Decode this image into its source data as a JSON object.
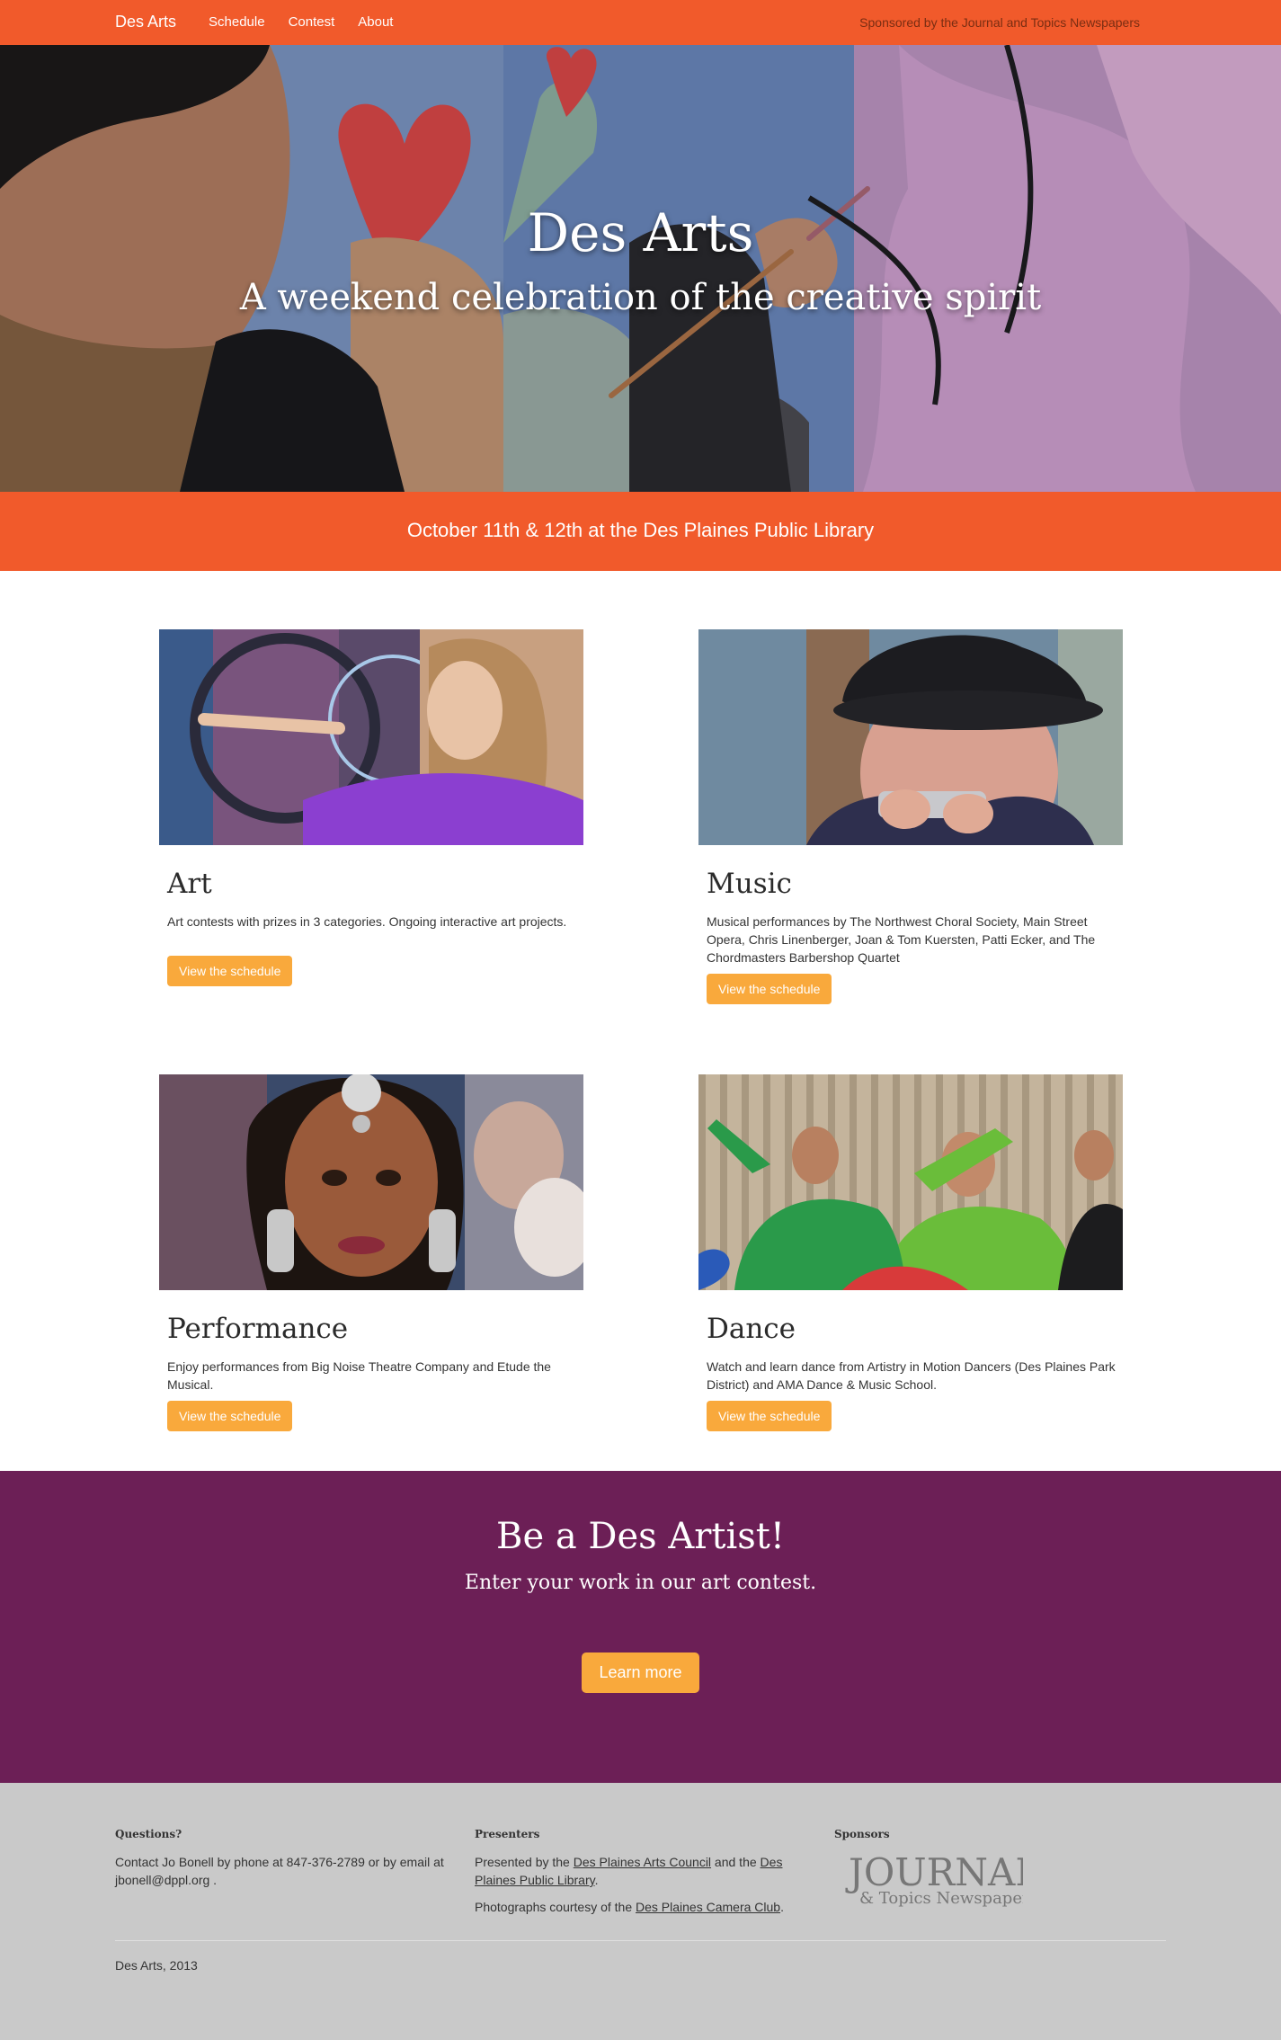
{
  "navbar": {
    "brand": "Des Arts",
    "links": [
      "Schedule",
      "Contest",
      "About"
    ],
    "sponsor": "Sponsored by the Journal and Topics Newspapers"
  },
  "hero": {
    "title": "Des Arts",
    "subtitle": "A weekend celebration of the creative spirit"
  },
  "date_band": {
    "text": "October 11th & 12th at the Des Plaines Public Library"
  },
  "features": [
    {
      "title": "Art",
      "description": "Art contests with prizes in 3 categories. Ongoing interactive art projects.",
      "button": "View the schedule"
    },
    {
      "title": "Music",
      "description": "Musical performances by The Northwest Choral Society, Main Street Opera, Chris Linenberger, Joan & Tom Kuersten, Patti Ecker, and The Chordmasters Barbershop Quartet",
      "button": "View the schedule"
    },
    {
      "title": "Performance",
      "description": "Enjoy performances from Big Noise Theatre Company and Etude the Musical.",
      "button": "View the schedule"
    },
    {
      "title": "Dance",
      "description": "Watch and learn dance from Artistry in Motion Dancers (Des Plaines Park District) and AMA Dance & Music School.",
      "button": "View the schedule"
    }
  ],
  "cta": {
    "title": "Be a Des Artist!",
    "subtitle": "Enter your work in our art contest.",
    "button": "Learn more"
  },
  "footer": {
    "questions": {
      "heading": "Questions?",
      "text": "Contact Jo Bonell by phone at 847-376-2789 or by email at jbonell@dppl.org ."
    },
    "presenters": {
      "heading": "Presenters",
      "line1_prefix": "Presented by the ",
      "link1": "Des Plaines Arts Council",
      "line1_mid": " and the ",
      "link2": "Des Plaines Public Library",
      "line1_suffix": ".",
      "line2_prefix": "Photographs courtesy of the ",
      "link3": "Des Plaines Camera Club",
      "line2_suffix": "."
    },
    "sponsors": {
      "heading": "Sponsors",
      "logo_line1": "JOURNAL",
      "logo_line2": "& Topics Newspapers"
    },
    "copyright": "Des Arts, 2013"
  },
  "colors": {
    "brand_orange": "#f15a2b",
    "button_amber": "#f9a93c",
    "cta_purple": "#6c1f56",
    "footer_gray": "#c9c9c9"
  }
}
